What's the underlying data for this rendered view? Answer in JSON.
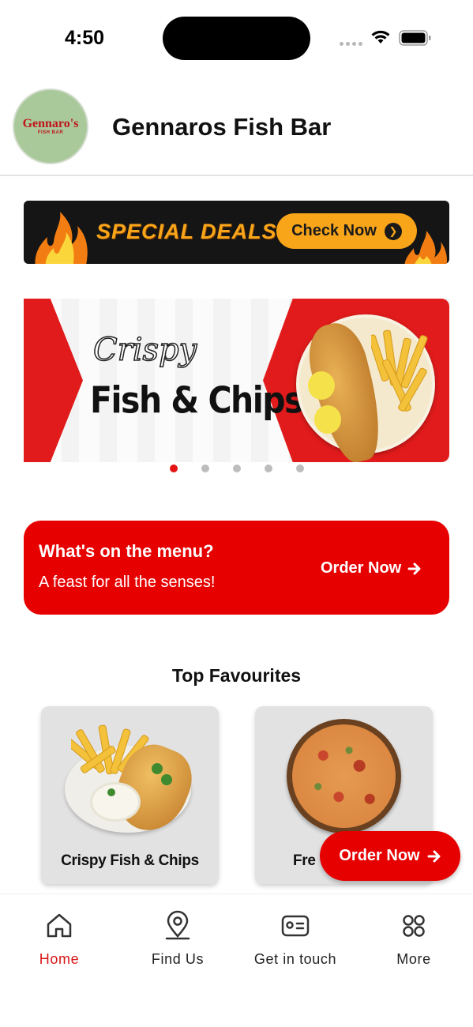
{
  "status_bar": {
    "time": "4:50"
  },
  "header": {
    "logo_title": "Gennaro's",
    "logo_subtitle": "FISH BAR",
    "title": "Gennaros Fish Bar"
  },
  "deals_banner": {
    "text": "SPECIAL DEALS",
    "button_label": "Check Now"
  },
  "hero": {
    "script_text": "Crispy",
    "title": "Fish & Chips",
    "slide_count": 5,
    "active_slide": 1
  },
  "menu_card": {
    "title": "What's on the menu?",
    "subtitle": "A feast for all the senses!",
    "button_label": "Order Now"
  },
  "favourites": {
    "heading": "Top Favourites",
    "items": [
      {
        "label": "Crispy Fish & Chips"
      },
      {
        "label": "Fre"
      }
    ]
  },
  "float_button": {
    "label": "Order Now"
  },
  "bottom_nav": {
    "items": [
      {
        "label": "Home",
        "icon": "home-icon",
        "active": true
      },
      {
        "label": "Find Us",
        "icon": "location-icon",
        "active": false
      },
      {
        "label": "Get in touch",
        "icon": "contact-card-icon",
        "active": false
      },
      {
        "label": "More",
        "icon": "grid-icon",
        "active": false
      }
    ]
  },
  "colors": {
    "accent": "#e60000",
    "active_nav": "#d91414",
    "deals_orange": "#f9a51a"
  }
}
